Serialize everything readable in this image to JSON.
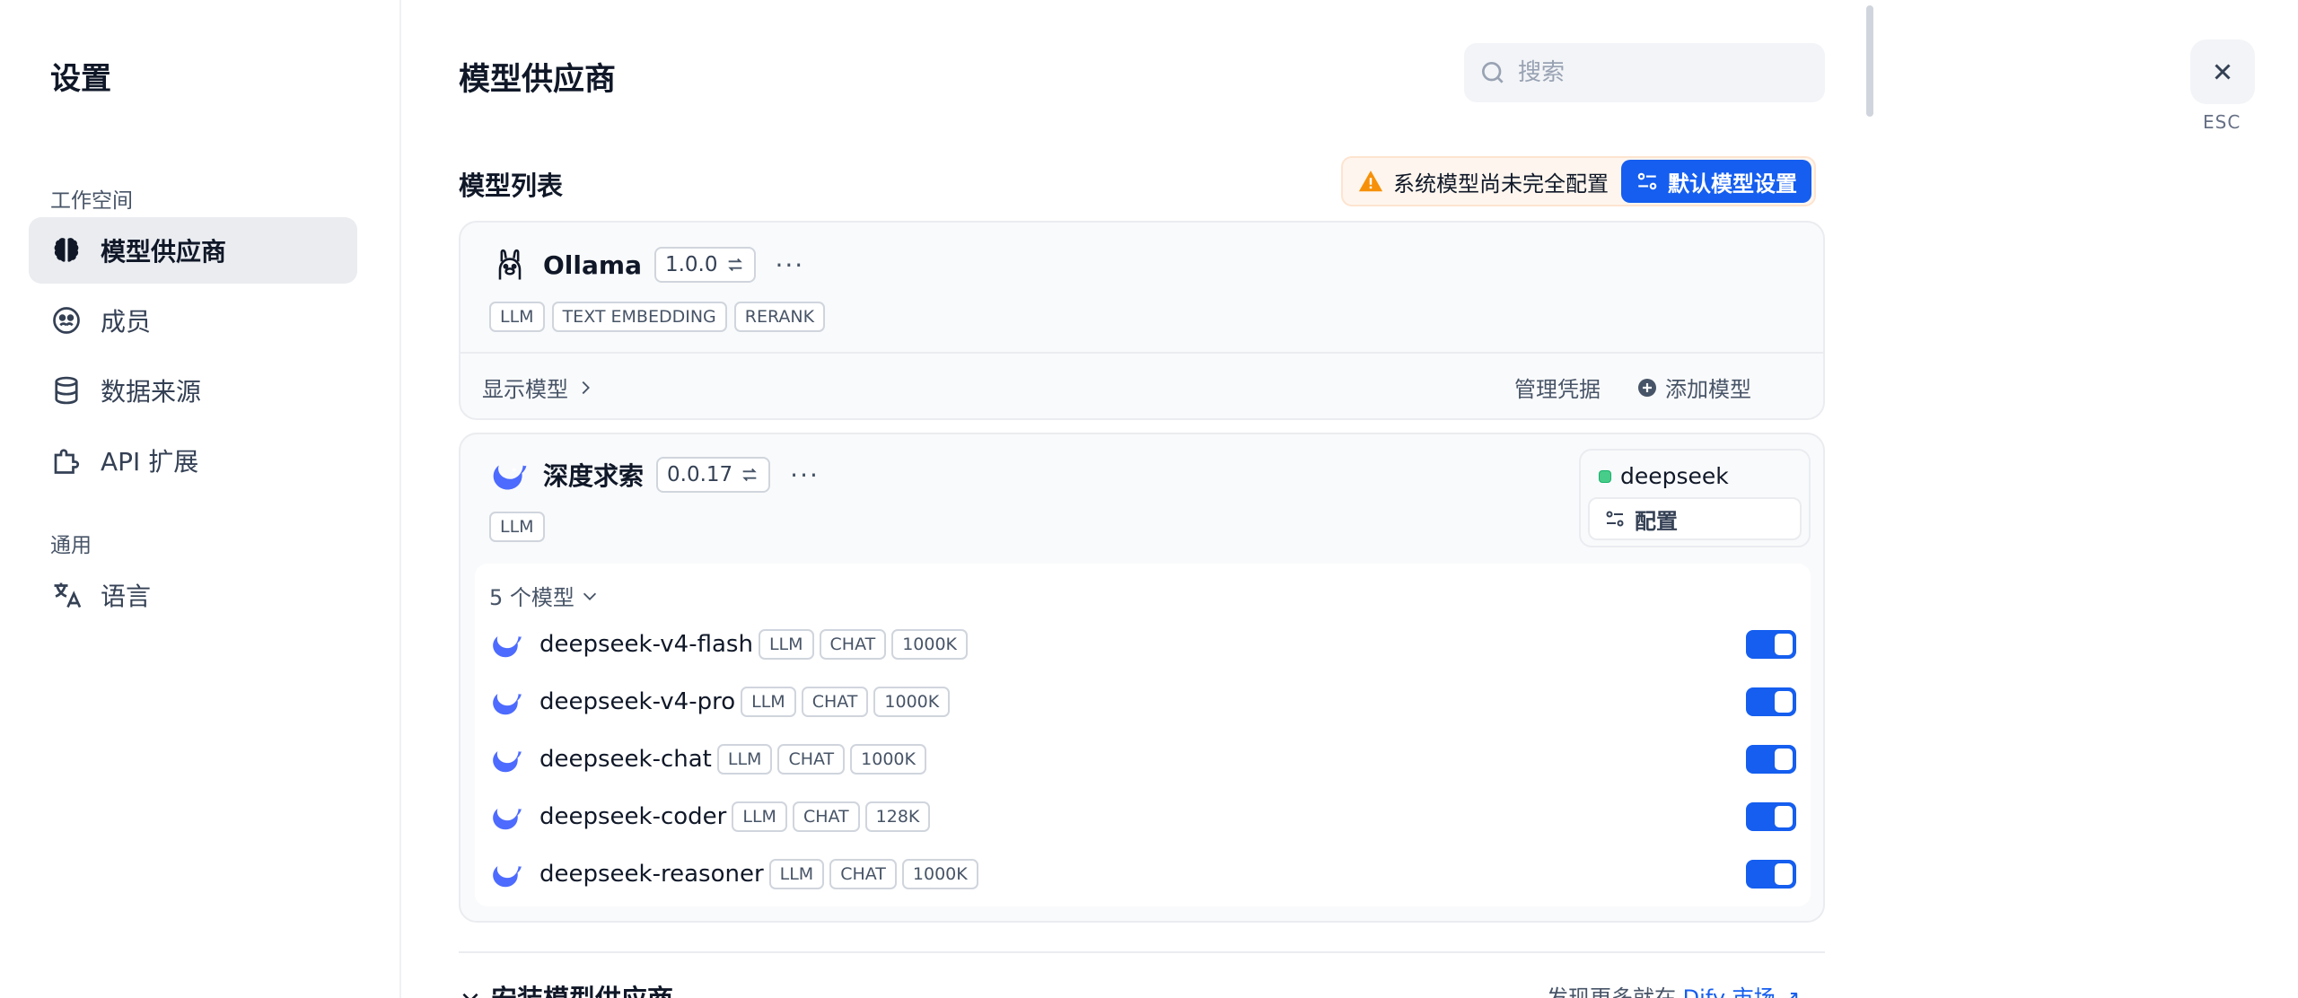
{
  "sidebar": {
    "title": "设置",
    "workspace_label": "工作空间",
    "general_label": "通用",
    "items": [
      {
        "label": "模型供应商",
        "icon": "brain-icon",
        "active": true
      },
      {
        "label": "成员",
        "icon": "members-icon",
        "active": false
      },
      {
        "label": "数据来源",
        "icon": "database-icon",
        "active": false
      },
      {
        "label": "API 扩展",
        "icon": "puzzle-icon",
        "active": false
      }
    ],
    "language_item": {
      "label": "语言",
      "icon": "translate-icon"
    }
  },
  "header": {
    "title": "模型供应商",
    "search_placeholder": "搜索"
  },
  "model_list": {
    "title": "模型列表",
    "warning_text": "系统模型尚未完全配置",
    "default_settings_label": "默认模型设置"
  },
  "providers": [
    {
      "name": "Ollama",
      "version": "1.0.0",
      "tags": [
        "LLM",
        "TEXT EMBEDDING",
        "RERANK"
      ],
      "show_models_label": "显示模型",
      "manage_credentials_label": "管理凭据",
      "add_model_label": "添加模型"
    },
    {
      "name": "深度求索",
      "version": "0.0.17",
      "tags": [
        "LLM"
      ],
      "credential_name": "deepseek",
      "config_label": "配置",
      "models_count_label": "5 个模型",
      "models": [
        {
          "name": "deepseek-v4-flash",
          "tags": [
            "LLM",
            "CHAT",
            "1000K"
          ],
          "enabled": true
        },
        {
          "name": "deepseek-v4-pro",
          "tags": [
            "LLM",
            "CHAT",
            "1000K"
          ],
          "enabled": true
        },
        {
          "name": "deepseek-chat",
          "tags": [
            "LLM",
            "CHAT",
            "1000K"
          ],
          "enabled": true
        },
        {
          "name": "deepseek-coder",
          "tags": [
            "LLM",
            "CHAT",
            "128K"
          ],
          "enabled": true
        },
        {
          "name": "deepseek-reasoner",
          "tags": [
            "LLM",
            "CHAT",
            "1000K"
          ],
          "enabled": true
        }
      ]
    }
  ],
  "footer": {
    "install_label": "安装模型供应商",
    "discover_text": "发现更多就在",
    "marketplace_link": "Dify 市场"
  },
  "close": {
    "esc_label": "ESC"
  },
  "colors": {
    "accent": "#155eef",
    "warning": "#f79009",
    "status_ok": "#47cd89"
  }
}
